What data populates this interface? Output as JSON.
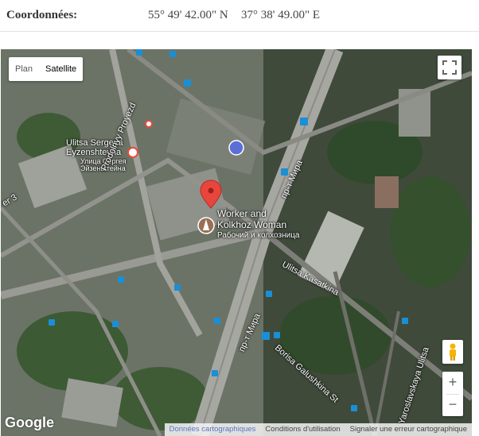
{
  "coordinates": {
    "label": "Coordonnées:",
    "latitude": "55° 49' 42.00\" N",
    "longitude": "37° 38' 49.00\" E"
  },
  "map": {
    "type_control": {
      "plan": "Plan",
      "satellite": "Satellite",
      "active": "satellite"
    },
    "labels": {
      "street_sergeya_latin": "Ulitsa Sergeya",
      "street_sergeya_latin2": "Eyzenshteyna",
      "street_sergeya_cyr1": "Улица Сергея",
      "street_sergeya_cyr2": "Эйзенштейна",
      "prodolny": "Prodolnyy Proyezd",
      "pr_mira_top": "пр-т Мира",
      "pr_mira_bottom": "пр-т Мира",
      "place_name_1": "Worker and",
      "place_name_2": "Kolkhoz Woman",
      "place_name_cyr": "Рабочий и колхозница",
      "kasatkina": "Ulitsa Kasatkina",
      "galushkina": "Borisa Galushkina St",
      "yaroslavskaya": "Yaroslavskaya Ulitsa",
      "edge_left": "er 3"
    },
    "google": "Google",
    "attribution": {
      "data": "Données cartographiques",
      "terms": "Conditions d'utilisation",
      "report": "Signaler une erreur cartographique"
    },
    "zoom": {
      "in": "+",
      "out": "−"
    }
  },
  "colors": {
    "pin": "#e8453c",
    "transit_blue": "#1a8fd6",
    "metro_red": "#e74c3c"
  }
}
